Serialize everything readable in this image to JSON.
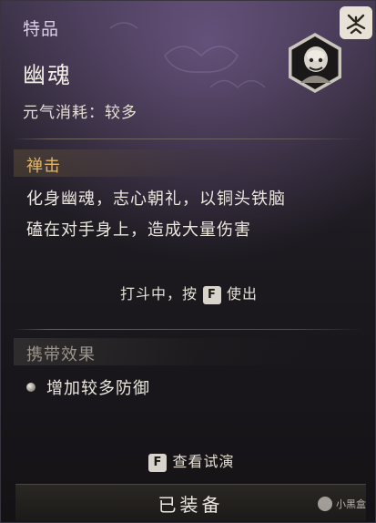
{
  "tooltip": {
    "rarity": "特品",
    "name": "幽魂",
    "cost": "元气消耗：较多",
    "corner_badge_glyph": "ᐎ",
    "portrait_icon": "ghost-monk-portrait-icon"
  },
  "skill": {
    "title": "禅击",
    "description_line1": "化身幽魂，志心朝礼，以铜头铁脑",
    "description_line2": "磕在对手身上，造成大量伤害",
    "usage_prefix": "打斗中，按",
    "usage_key": "F",
    "usage_suffix": "使出"
  },
  "carry_effect": {
    "title": "携带效果",
    "items": [
      "增加较多防御"
    ]
  },
  "actions": {
    "preview_key": "F",
    "preview_label": "查看试演",
    "equip_label": "已装备"
  },
  "watermark": "小黑盒",
  "colors": {
    "gold": "#e2b66a",
    "muted": "#9b948c",
    "panel_top": "#3a3146",
    "panel_bottom": "#141215"
  }
}
